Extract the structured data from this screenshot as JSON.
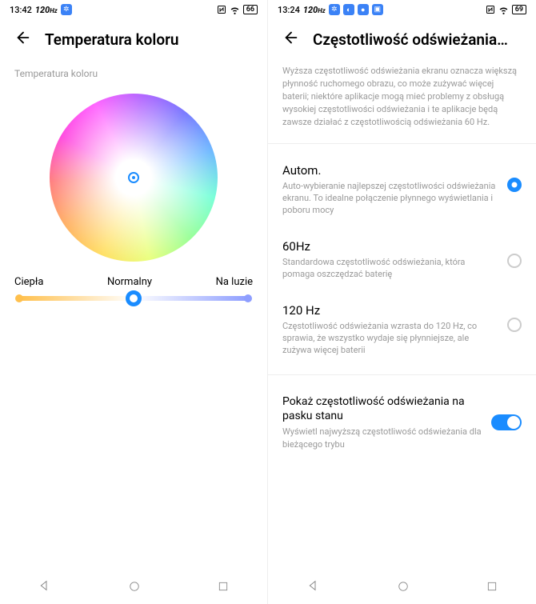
{
  "left": {
    "statusbar": {
      "time": "13:42",
      "rate": "120",
      "hz": "Hz",
      "battery": "66"
    },
    "title": "Temperatura koloru",
    "section_label": "Temperatura koloru",
    "labels": {
      "warm": "Ciepła",
      "normal": "Normalny",
      "cool": "Na luzie"
    }
  },
  "right": {
    "statusbar": {
      "time": "13:24",
      "rate": "120",
      "hz": "Hz",
      "battery": "69"
    },
    "title": "Częstotliwość odświeżania…",
    "description": "Wyższa częstotliwość odświeżania ekranu oznacza większą płynność ruchomego obrazu, co może zużywać więcej baterii; niektóre aplikacje mogą mieć problemy z obsługą wysokiej częstotliwości odświeżania i te aplikacje będą zawsze działać z częstotliwością odświeżania 60 Hz.",
    "options": [
      {
        "title": "Autom.",
        "desc": "Auto-wybieranie najlepszej częstotliwości odświeżania ekranu. To idealne połączenie płynnego wyświetlania i poboru mocy",
        "checked": true
      },
      {
        "title": "60Hz",
        "desc": "Standardowa częstotliwość odświeżania, która pomaga oszczędzać baterię",
        "checked": false
      },
      {
        "title": "120 Hz",
        "desc": "Częstotliwość odświeżania wzrasta do 120 Hz, co sprawia, że wszystko wydaje się płynniejsze, ale zużywa więcej baterii",
        "checked": false
      }
    ],
    "toggle": {
      "title": "Pokaż częstotliwość odświeżania na pasku stanu",
      "desc": "Wyświetl najwyższą częstotliwość odświeżania dla bieżącego trybu",
      "on": true
    }
  }
}
